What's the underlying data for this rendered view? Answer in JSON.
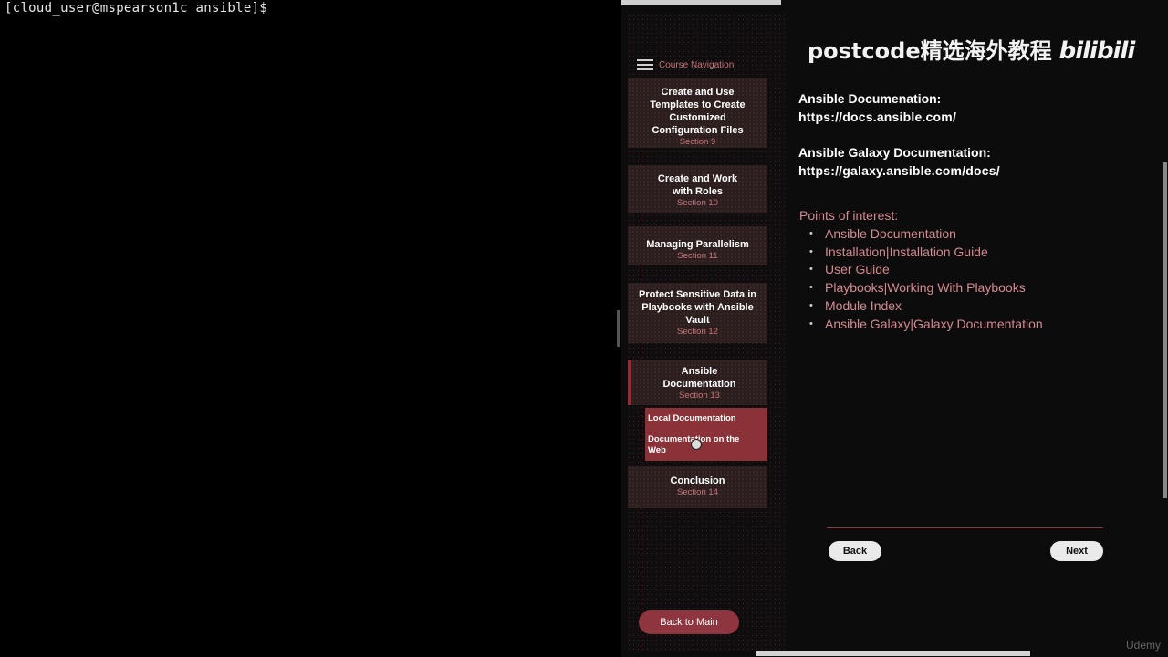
{
  "terminal": {
    "prompt": "[cloud_user@mspearson1c ansible]$"
  },
  "sidebar": {
    "nav_title": "Course Navigation",
    "items": [
      {
        "title": "Create and Use Templates to Create Customized Configuration Files",
        "section": "Section 9"
      },
      {
        "title": "Create and Work with Roles",
        "section": "Section 10"
      },
      {
        "title": "Managing Parallelism",
        "section": "Section 11"
      },
      {
        "title": "Protect Sensitive Data in Playbooks with Ansible Vault",
        "section": "Section 12"
      },
      {
        "title": "Ansible Documentation",
        "section": "Section 13"
      },
      {
        "title": "Conclusion",
        "section": "Section 14"
      }
    ],
    "sub_items": [
      "Local Documentation",
      "Documentation on the Web"
    ],
    "back_to_main": "Back to Main"
  },
  "content": {
    "watermark": "postcode精选海外教程",
    "watermark_logo": "bilibili",
    "ansible_doc_label": "Ansible Documenation:",
    "ansible_doc_url": "https://docs.ansible.com/",
    "galaxy_doc_label": "Ansible Galaxy Documentation:",
    "galaxy_doc_url": "https://galaxy.ansible.com/docs/",
    "points_label": "Points of interest:",
    "points": [
      "Ansible Documentation",
      "Installation|Installation Guide",
      "User Guide",
      "Playbooks|Working With Playbooks",
      "Module Index",
      "Ansible Galaxy|Galaxy Documentation"
    ],
    "back": "Back",
    "next": "Next"
  },
  "footer": {
    "brand": "Udemy"
  },
  "colors": {
    "accent": "#8e3540",
    "accent_text": "#d48a8f",
    "background": "#0d0c0c"
  }
}
